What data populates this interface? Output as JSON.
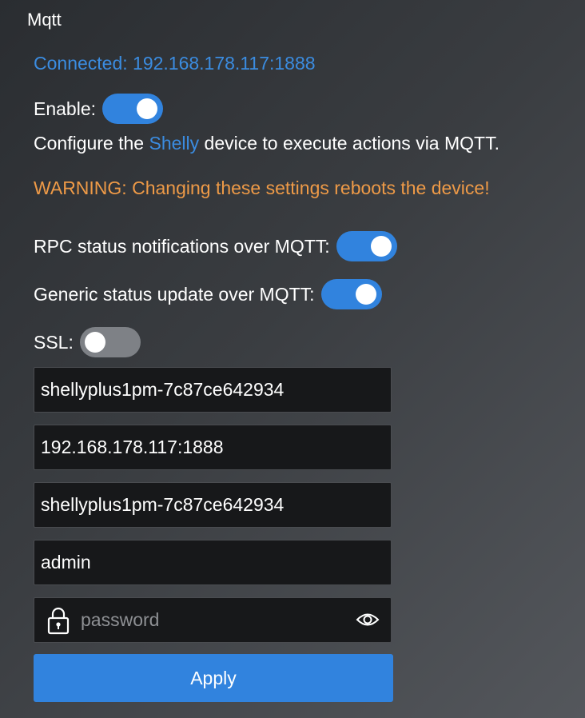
{
  "section_title": "Mqtt",
  "status": "Connected: 192.168.178.117:1888",
  "enable": {
    "label": "Enable:",
    "state": "on"
  },
  "description": {
    "prefix": "Configure the ",
    "link": "Shelly",
    "suffix": " device to execute actions via MQTT."
  },
  "warning": "WARNING: Changing these settings reboots the device!",
  "rpc_notifications": {
    "label": "RPC status notifications over MQTT:",
    "state": "on"
  },
  "generic_status": {
    "label": "Generic status update over MQTT:",
    "state": "on"
  },
  "ssl": {
    "label": "SSL:",
    "state": "off"
  },
  "fields": {
    "client_id": "shellyplus1pm-7c87ce642934",
    "server": "192.168.178.117:1888",
    "topic_prefix": "shellyplus1pm-7c87ce642934",
    "username": "admin",
    "password_placeholder": "password"
  },
  "apply_label": "Apply",
  "colors": {
    "accent": "#3183de",
    "link": "#3b8ce0",
    "warning": "#ee9a47",
    "toggle_off": "#7e8186"
  },
  "icons": {
    "lock": "lock-icon",
    "eye": "eye-icon"
  }
}
